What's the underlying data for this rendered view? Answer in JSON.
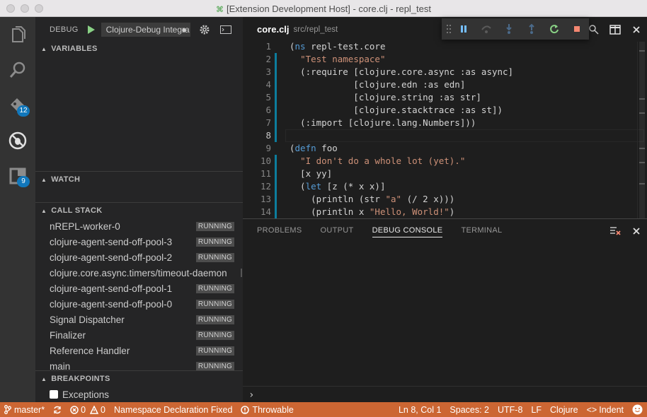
{
  "window": {
    "title": "[Extension Development Host] - core.clj - repl_test"
  },
  "activity_bar": {
    "extensions_badge": "12",
    "explorer_badge": "9"
  },
  "debug": {
    "title": "DEBUG",
    "config": "Clojure-Debug Integrated",
    "config_arrows": "◆"
  },
  "sections": {
    "variables": "VARIABLES",
    "watch": "WATCH",
    "call_stack": "CALL STACK",
    "breakpoints": "BREAKPOINTS"
  },
  "call_stack": [
    {
      "name": "nREPL-worker-0",
      "state": "RUNNING"
    },
    {
      "name": "clojure-agent-send-off-pool-3",
      "state": "RUNNING"
    },
    {
      "name": "clojure-agent-send-off-pool-2",
      "state": "RUNNING"
    },
    {
      "name": "clojure.core.async.timers/timeout-daemon",
      "state": ""
    },
    {
      "name": "clojure-agent-send-off-pool-1",
      "state": "RUNNING"
    },
    {
      "name": "clojure-agent-send-off-pool-0",
      "state": "RUNNING"
    },
    {
      "name": "Signal Dispatcher",
      "state": "RUNNING"
    },
    {
      "name": "Finalizer",
      "state": "RUNNING"
    },
    {
      "name": "Reference Handler",
      "state": "RUNNING"
    },
    {
      "name": "main",
      "state": "RUNNING"
    }
  ],
  "breakpoints": {
    "exceptions_label": "Exceptions"
  },
  "editor": {
    "tab_name": "core.clj",
    "tab_path": "src/repl_test",
    "lines": [
      {
        "n": "1",
        "tokens": [
          [
            "plain",
            "("
          ],
          [
            "kw",
            "ns"
          ],
          [
            "plain",
            " repl-test.core"
          ]
        ]
      },
      {
        "n": "2",
        "tokens": [
          [
            "plain",
            "  "
          ],
          [
            "str",
            "\"Test namespace\""
          ]
        ]
      },
      {
        "n": "3",
        "tokens": [
          [
            "plain",
            "  (:require [clojure.core.async :as async]"
          ]
        ]
      },
      {
        "n": "4",
        "tokens": [
          [
            "plain",
            "            [clojure.edn :as edn]"
          ]
        ]
      },
      {
        "n": "5",
        "tokens": [
          [
            "plain",
            "            [clojure.string :as str]"
          ]
        ]
      },
      {
        "n": "6",
        "tokens": [
          [
            "plain",
            "            [clojure.stacktrace :as st])"
          ]
        ]
      },
      {
        "n": "7",
        "tokens": [
          [
            "plain",
            "  (:import [clojure.lang.Numbers]))"
          ]
        ]
      },
      {
        "n": "8",
        "tokens": []
      },
      {
        "n": "9",
        "tokens": [
          [
            "plain",
            "("
          ],
          [
            "kw",
            "defn"
          ],
          [
            "plain",
            " foo"
          ]
        ]
      },
      {
        "n": "10",
        "tokens": [
          [
            "plain",
            "  "
          ],
          [
            "str",
            "\"I don't do a whole lot (yet).\""
          ]
        ]
      },
      {
        "n": "11",
        "tokens": [
          [
            "plain",
            "  [x yy]"
          ]
        ]
      },
      {
        "n": "12",
        "tokens": [
          [
            "plain",
            "  ("
          ],
          [
            "kw",
            "let"
          ],
          [
            "plain",
            " [z (* x x)]"
          ]
        ]
      },
      {
        "n": "13",
        "tokens": [
          [
            "plain",
            "    (println (str "
          ],
          [
            "str",
            "\"a\""
          ],
          [
            "plain",
            " (/ 2 x)))"
          ]
        ]
      },
      {
        "n": "14",
        "tokens": [
          [
            "plain",
            "    (println x "
          ],
          [
            "str",
            "\"Hello, World!\""
          ],
          [
            "plain",
            ")"
          ]
        ]
      }
    ],
    "modified_lines": [
      2,
      3,
      4,
      5,
      6,
      7,
      8,
      10,
      11,
      12,
      13,
      14
    ],
    "current_line": 8
  },
  "panel": {
    "tabs": [
      "PROBLEMS",
      "OUTPUT",
      "DEBUG CONSOLE",
      "TERMINAL"
    ],
    "active_tab": "DEBUG CONSOLE",
    "prompt": "›"
  },
  "status_bar": {
    "branch": "master*",
    "errors": "0",
    "warnings": "0",
    "message1": "Namespace Declaration Fixed",
    "message2": "Throwable",
    "position": "Ln 8, Col 1",
    "spaces": "Spaces: 2",
    "encoding": "UTF-8",
    "eol": "LF",
    "language": "Clojure",
    "indent": "Indent",
    "color": "#cc6633"
  }
}
